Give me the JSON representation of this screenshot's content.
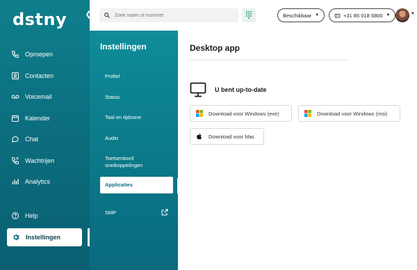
{
  "app": {
    "logo": "dstny"
  },
  "nav": {
    "items": [
      {
        "label": "Oproepen",
        "icon": "phone-icon"
      },
      {
        "label": "Contacten",
        "icon": "contacts-icon"
      },
      {
        "label": "Voicemail",
        "icon": "voicemail-icon"
      },
      {
        "label": "Kalender",
        "icon": "calendar-icon"
      },
      {
        "label": "Chat",
        "icon": "chat-icon"
      },
      {
        "label": "Wachtrijen",
        "icon": "queue-icon"
      },
      {
        "label": "Analytics",
        "icon": "analytics-icon"
      }
    ],
    "help": {
      "label": "Help",
      "icon": "help-icon"
    },
    "settings": {
      "label": "Instellingen",
      "icon": "gear-icon"
    }
  },
  "settings_menu": {
    "title": "Instellingen",
    "items": [
      {
        "label": "Profiel"
      },
      {
        "label": "Status"
      },
      {
        "label": "Taal en tijdzone"
      },
      {
        "label": "Audio"
      },
      {
        "label_line1": "Toetsenbord",
        "label_line2": "sneikoppelingen"
      },
      {
        "label": "Applicaties"
      },
      {
        "label": "SMP"
      }
    ]
  },
  "topbar": {
    "search_placeholder": "Zoek naam of nummer",
    "availability": "Beschikbaar",
    "phone_number": "+31 85 018 5800"
  },
  "main": {
    "title": "Desktop app",
    "status_text": "U bent up-to-date",
    "buttons": {
      "win_exe": "Download voor Windows (exe)",
      "win_msi": "Download voor Windows (msi)",
      "mac": "Download voor Mac"
    }
  },
  "colors": {
    "nav_teal": "#0c6f7f",
    "settings_teal": "#0f8c99",
    "ms_red": "#f25022",
    "ms_green": "#7fba00",
    "ms_blue": "#00a4ef",
    "ms_yellow": "#ffb900"
  }
}
